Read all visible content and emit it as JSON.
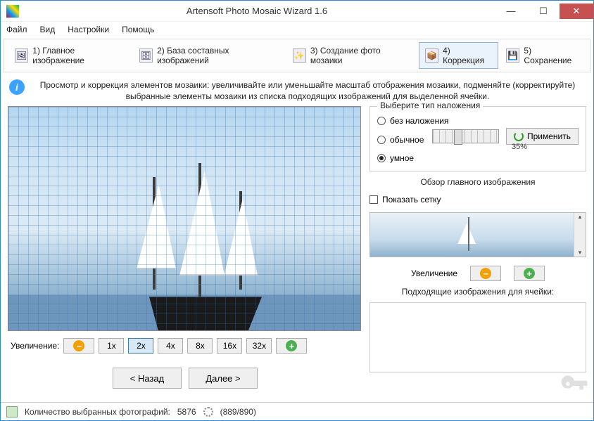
{
  "window": {
    "title": "Artensoft Photo Mosaic Wizard 1.6"
  },
  "menu": {
    "file": "Файл",
    "view": "Вид",
    "settings": "Настройки",
    "help": "Помощь"
  },
  "steps": {
    "s1": "1) Главное изображение",
    "s2": "2) База составных изображений",
    "s3": "3) Создание фото мозаики",
    "s4": "4) Коррекция",
    "s5": "5) Сохранение"
  },
  "info": {
    "line1": "Просмотр и коррекция элементов мозаики: увеличивайте или уменьшайте масштаб отображения мозаики, подменяйте (корректируйте)",
    "line2": "выбранные элементы мозаики из списка подходящих изображений для выделенной ячейки."
  },
  "zoom": {
    "label": "Увеличение:",
    "b1": "1x",
    "b2": "2x",
    "b4": "4x",
    "b8": "8x",
    "b16": "16x",
    "b32": "32x"
  },
  "nav": {
    "back": "< Назад",
    "next": "Далее >"
  },
  "overlay": {
    "legend": "Выберите тип наложения",
    "none": "без наложения",
    "normal": "обычное",
    "smart": "умное",
    "percent": "35%",
    "apply": "Применить"
  },
  "preview": {
    "title": "Обзор главного изображения",
    "showgrid": "Показать сетку",
    "zoomlabel": "Увеличение"
  },
  "suitable": {
    "title": "Подходящие изображения для ячейки:"
  },
  "status": {
    "count_label": "Количество выбранных фотографий:",
    "count_value": "5876",
    "progress": "(889/890)"
  }
}
